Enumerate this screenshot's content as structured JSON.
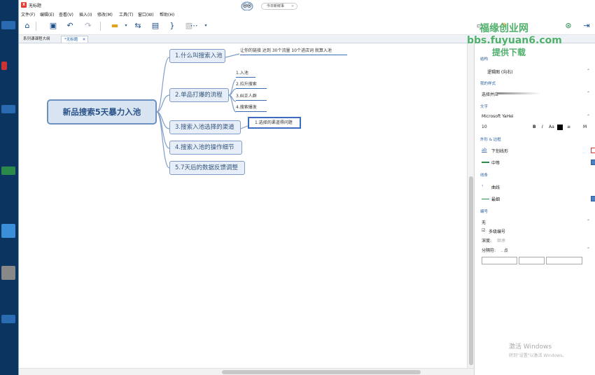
{
  "window": {
    "title": "无标题",
    "today_pill": "今日新鲜事"
  },
  "menu": [
    "文件(F)",
    "编辑(E)",
    "查看(V)",
    "插入(I)",
    "修改(M)",
    "工具(T)",
    "窗口(W)",
    "帮助(H)"
  ],
  "tabs": [
    {
      "label": "系列课课程大纲"
    },
    {
      "label": "*无标题"
    }
  ],
  "mindmap": {
    "central": "新品搜索5天暴力入池",
    "branches": [
      {
        "label": "1.什么叫搜索入池",
        "note": "让你的链接 达到  30个流量  10个进店词 就算入池"
      },
      {
        "label": "2.单品打爆的流程",
        "children": [
          "1.入池",
          "2.拉升搜索",
          "3.纠正人群",
          "4.搜索爆发"
        ]
      },
      {
        "label": "3.搜索入池选择的渠道",
        "children": [
          "1.选择的渠道得问题"
        ]
      },
      {
        "label": "4.搜索入池的操作细节"
      },
      {
        "label": "5.7天后的数据反馈调整"
      }
    ]
  },
  "panel": {
    "sections": {
      "structure": "结构",
      "my_style": "我的样式",
      "text": "文字",
      "shape_border": "外形 & 边框",
      "line": "线条",
      "numbering": "编号"
    },
    "structure_value": "逻辑图 (向右)",
    "style_value": "选择并应",
    "font_name": "Microsoft YaHei",
    "font_size": "10",
    "font_buttons": [
      "B",
      "I",
      "Aa"
    ],
    "shape_value": "下划线形",
    "border_value": "中等",
    "line_shape": "曲线",
    "line_width": "最细",
    "numbering_value": "无",
    "multi_level": "多级编号",
    "depth_label": "深度:",
    "depth_value": "继承",
    "separator_label": "分隔符:",
    "separator_value": ". 点"
  },
  "watermark": {
    "line1": "福缘创业网",
    "line2": "bbs.fuyuan6.com",
    "line3": "提供下载"
  },
  "os": {
    "activate_title": "激活 Windows",
    "activate_sub": "转到\"设置\"以激活 Windows。"
  }
}
